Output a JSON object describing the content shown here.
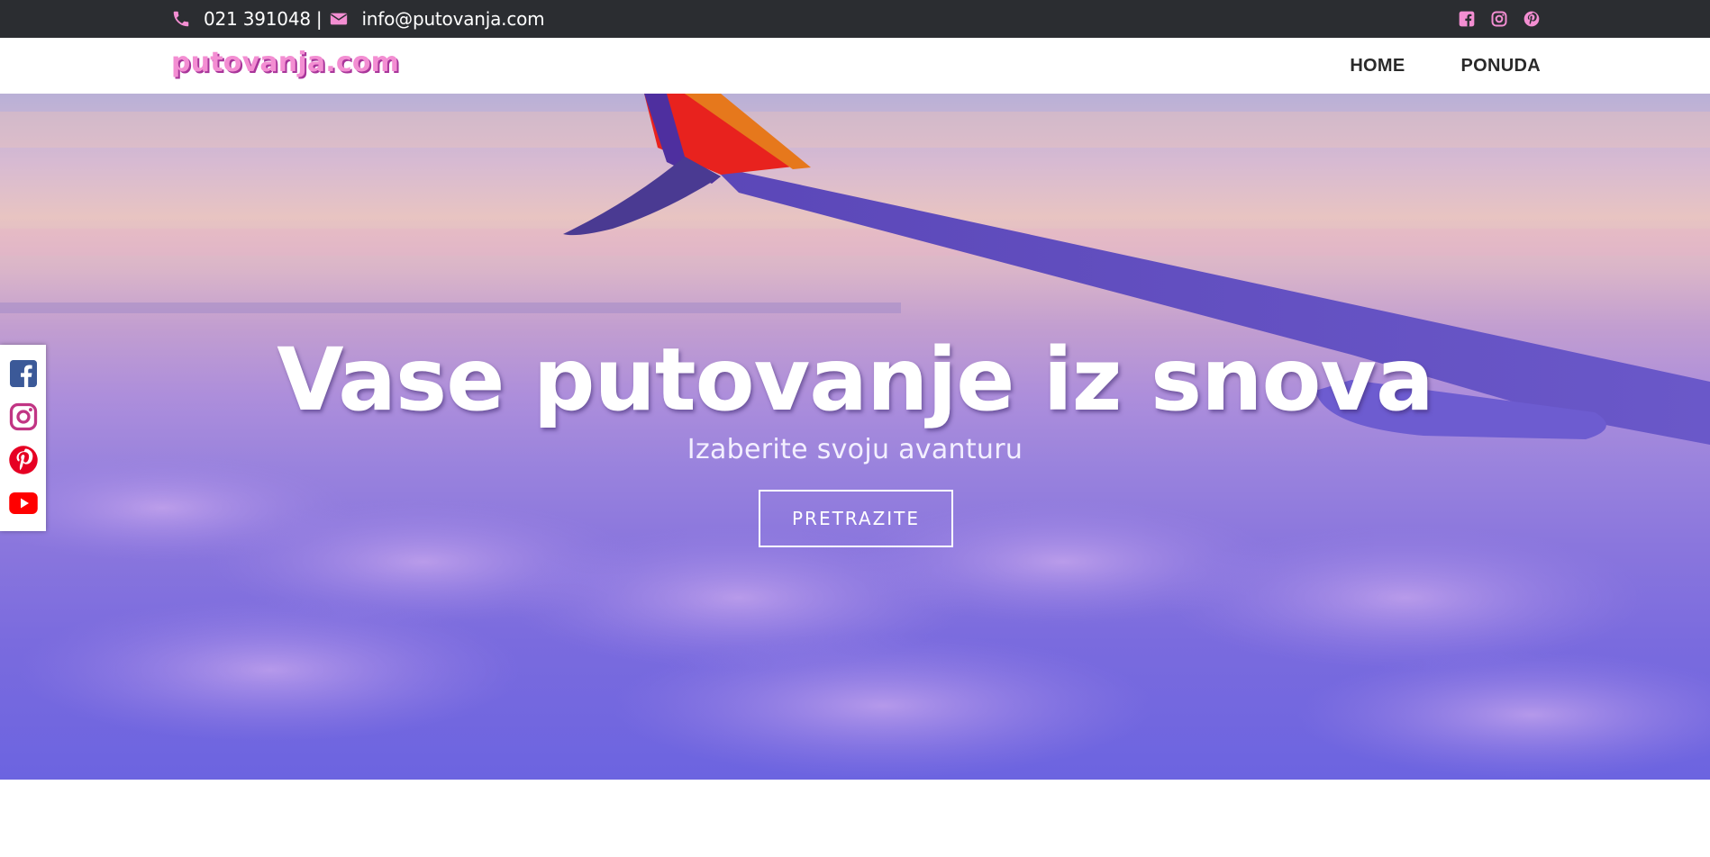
{
  "topbar": {
    "phone": "021 391048",
    "separator": "|",
    "email": "info@putovanja.com",
    "icons": [
      "phone-icon",
      "envelope-icon"
    ],
    "social_icons": [
      "facebook-icon",
      "instagram-icon",
      "pinterest-icon"
    ],
    "accent_color": "#f38ed2",
    "background": "#2b2d31"
  },
  "navbar": {
    "brand": "putovanja.com",
    "items": [
      {
        "label": "HOME"
      },
      {
        "label": "PONUDA"
      }
    ]
  },
  "hero": {
    "title": "Vase putovanje iz snova",
    "subtitle": "Izaberite svoju avanturu",
    "button_label": "PRETRAZITE"
  },
  "side_social": {
    "icons": [
      "facebook-icon",
      "instagram-icon",
      "pinterest-icon",
      "youtube-icon"
    ],
    "colors": {
      "facebook": "#3b5998",
      "instagram": "#c13584",
      "pinterest": "#e60023",
      "youtube": "#ff0000"
    }
  }
}
